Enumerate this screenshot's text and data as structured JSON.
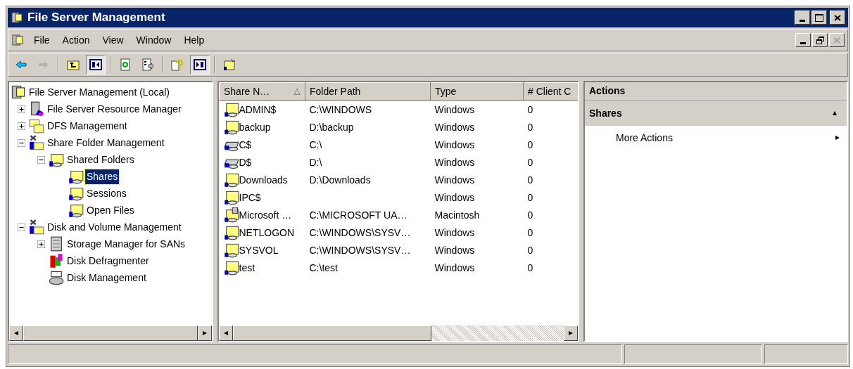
{
  "window": {
    "title": "File Server Management"
  },
  "menu": [
    "File",
    "Action",
    "View",
    "Window",
    "Help"
  ],
  "toolbar": [
    {
      "kind": "back",
      "disabled": false,
      "pressed": false
    },
    {
      "kind": "forward",
      "disabled": true,
      "pressed": false
    },
    {
      "kind": "separator"
    },
    {
      "kind": "up",
      "disabled": false,
      "pressed": false
    },
    {
      "kind": "tree-toggle",
      "disabled": false,
      "pressed": true
    },
    {
      "kind": "separator"
    },
    {
      "kind": "refresh",
      "disabled": false,
      "pressed": false
    },
    {
      "kind": "export",
      "disabled": false,
      "pressed": false
    },
    {
      "kind": "separator"
    },
    {
      "kind": "help",
      "disabled": false,
      "pressed": false
    },
    {
      "kind": "action-toggle",
      "disabled": false,
      "pressed": true
    },
    {
      "kind": "separator"
    },
    {
      "kind": "wizard",
      "disabled": false,
      "pressed": false
    }
  ],
  "tree": [
    {
      "label": "File Server Management (Local)",
      "kind": "root",
      "selected": false,
      "children": [
        {
          "label": "File Server Resource Manager",
          "kind": "server",
          "expanded": false,
          "selected": false
        },
        {
          "label": "DFS Management",
          "kind": "dfs",
          "expanded": false,
          "selected": false
        },
        {
          "label": "Share Folder Management",
          "kind": "tools",
          "expanded": true,
          "selected": false,
          "children": [
            {
              "label": "Shared Folders",
              "kind": "share",
              "expanded": true,
              "selected": false,
              "children": [
                {
                  "label": "Shares",
                  "kind": "share",
                  "selected": true
                },
                {
                  "label": "Sessions",
                  "kind": "share",
                  "selected": false
                },
                {
                  "label": "Open Files",
                  "kind": "share",
                  "selected": false
                }
              ]
            }
          ]
        },
        {
          "label": "Disk and Volume Management",
          "kind": "tools",
          "expanded": true,
          "selected": false,
          "children": [
            {
              "label": "Storage Manager for SANs",
              "kind": "storage",
              "expanded": false,
              "selected": false
            },
            {
              "label": "Disk Defragmenter",
              "kind": "defrag",
              "selected": false
            },
            {
              "label": "Disk Management",
              "kind": "disk",
              "selected": false
            }
          ]
        }
      ]
    }
  ],
  "table": {
    "columns": [
      {
        "label": "Share N…",
        "sorted": true
      },
      {
        "label": "Folder Path",
        "sorted": false
      },
      {
        "label": "Type",
        "sorted": false
      },
      {
        "label": "# Client C",
        "sorted": false
      }
    ],
    "rows": [
      {
        "kind": "folder",
        "name": "ADMIN$",
        "path": "C:\\WINDOWS",
        "type": "Windows",
        "clients": "0"
      },
      {
        "kind": "folder",
        "name": "backup",
        "path": "D:\\backup",
        "type": "Windows",
        "clients": "0"
      },
      {
        "kind": "drive",
        "name": "C$",
        "path": "C:\\",
        "type": "Windows",
        "clients": "0"
      },
      {
        "kind": "drive",
        "name": "D$",
        "path": "D:\\",
        "type": "Windows",
        "clients": "0"
      },
      {
        "kind": "folder",
        "name": "Downloads",
        "path": "D:\\Downloads",
        "type": "Windows",
        "clients": "0"
      },
      {
        "kind": "folder",
        "name": "IPC$",
        "path": "",
        "type": "Windows",
        "clients": "0"
      },
      {
        "kind": "mac",
        "name": "Microsoft …",
        "path": "C:\\MICROSOFT UA…",
        "type": "Macintosh",
        "clients": "0"
      },
      {
        "kind": "folder",
        "name": "NETLOGON",
        "path": "C:\\WINDOWS\\SYSV…",
        "type": "Windows",
        "clients": "0"
      },
      {
        "kind": "folder",
        "name": "SYSVOL",
        "path": "C:\\WINDOWS\\SYSV…",
        "type": "Windows",
        "clients": "0"
      },
      {
        "kind": "folder",
        "name": "test",
        "path": "C:\\test",
        "type": "Windows",
        "clients": "0"
      }
    ]
  },
  "actions": {
    "title": "Actions",
    "sections": [
      {
        "title": "Shares",
        "expanded": true,
        "items": [
          {
            "label": "More Actions",
            "submenu": true
          }
        ]
      }
    ]
  }
}
